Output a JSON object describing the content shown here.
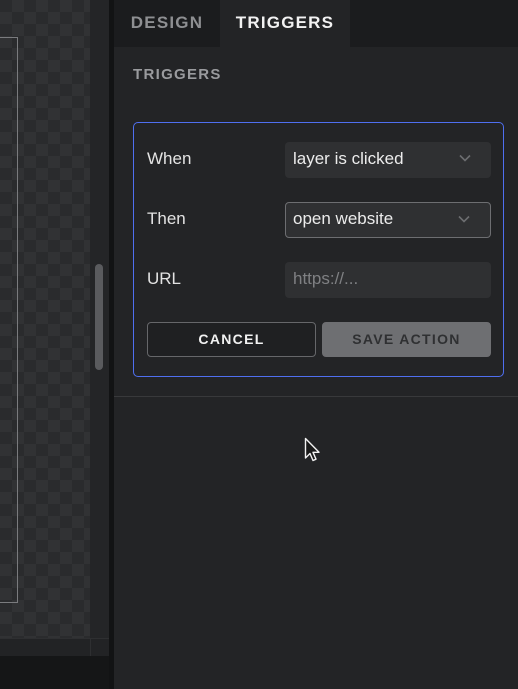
{
  "tabs": [
    {
      "label": "DESIGN",
      "active": false
    },
    {
      "label": "TRIGGERS",
      "active": true
    }
  ],
  "section": {
    "title": "TRIGGERS"
  },
  "trigger": {
    "when": {
      "label": "When",
      "value": "layer is clicked"
    },
    "then": {
      "label": "Then",
      "value": "open website"
    },
    "url": {
      "label": "URL",
      "placeholder": "https://..."
    },
    "cancel_label": "CANCEL",
    "save_label": "SAVE ACTION"
  },
  "icons": {
    "dropdown": "chevron-down-icon",
    "pointer": "mouse-pointer-icon"
  },
  "colors": {
    "accent": "#4f6ff0",
    "panel_bg": "#232426",
    "disabled_button": "#6e6f72"
  }
}
